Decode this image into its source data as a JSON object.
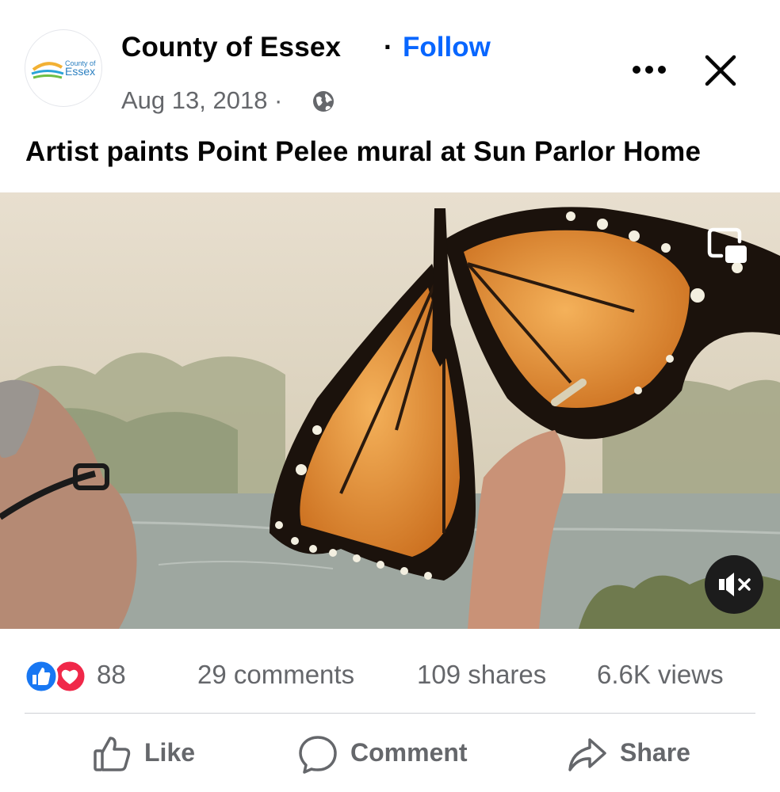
{
  "post": {
    "page_name": "County of Essex",
    "separator": "·",
    "follow_label": "Follow",
    "date": "Aug 13, 2018 ·",
    "audience_icon": "globe-icon",
    "caption": "Artist paints Point Pelee mural at Sun Parlor Home"
  },
  "logo": {
    "line1": "County of",
    "line2": "Essex"
  },
  "header_actions": {
    "more_icon": "more-icon",
    "close_icon": "close-icon"
  },
  "video": {
    "pip_icon": "picture-in-picture-icon",
    "mute_icon": "muted-speaker-icon"
  },
  "stats": {
    "reactions_count": "88",
    "comments": "29 comments",
    "shares": "109 shares",
    "views": "6.6K views"
  },
  "actions": {
    "like": "Like",
    "comment": "Comment",
    "share": "Share"
  },
  "colors": {
    "accent": "#0866ff",
    "like_blue": "#1877f2",
    "love_red": "#f02849",
    "secondary_text": "#65676b"
  }
}
